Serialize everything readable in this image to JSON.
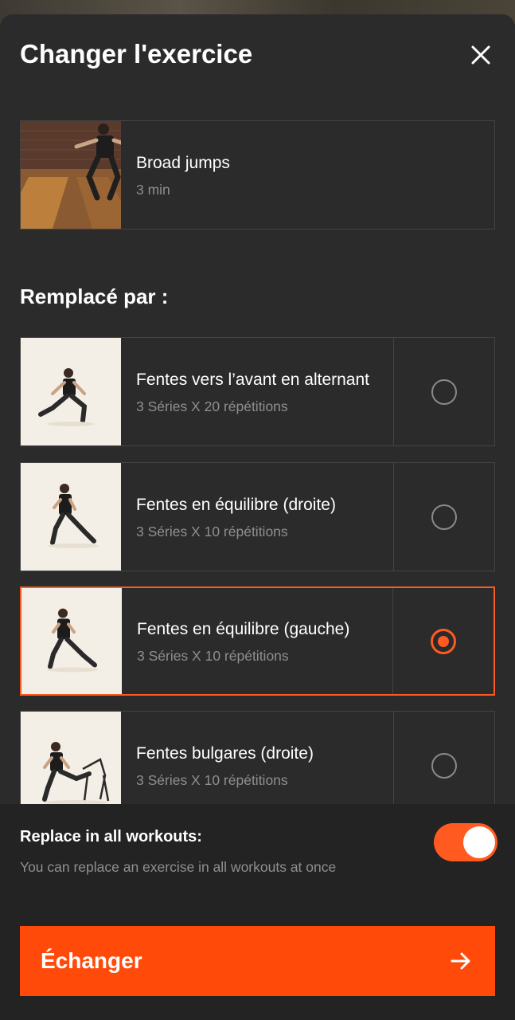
{
  "header": {
    "title": "Changer l'exercice"
  },
  "current": {
    "title": "Broad jumps",
    "subtitle": "3 min"
  },
  "replace_section": {
    "title": "Remplacé par :"
  },
  "options": [
    {
      "title": "Fentes vers l’avant en alternant",
      "subtitle": "3 Séries X 20 répétitions",
      "selected": false
    },
    {
      "title": "Fentes en équilibre (droite)",
      "subtitle": "3 Séries X 10 répétitions",
      "selected": false
    },
    {
      "title": "Fentes en équilibre (gauche)",
      "subtitle": "3 Séries X 10 répétitions",
      "selected": true
    },
    {
      "title": "Fentes bulgares (droite)",
      "subtitle": "3 Séries X 10 répétitions",
      "selected": false
    }
  ],
  "replace_all": {
    "label": "Replace in all workouts:",
    "description": "You can replace an exercise in all workouts at once",
    "enabled": true
  },
  "cta": {
    "label": "Échanger"
  },
  "colors": {
    "accent": "#ff5a1f",
    "cta": "#ff4a0a",
    "background": "#2b2b2b",
    "footer": "#232323"
  },
  "icons": {
    "close": "close-icon",
    "arrow": "arrow-right-icon",
    "radio": "radio-icon"
  }
}
